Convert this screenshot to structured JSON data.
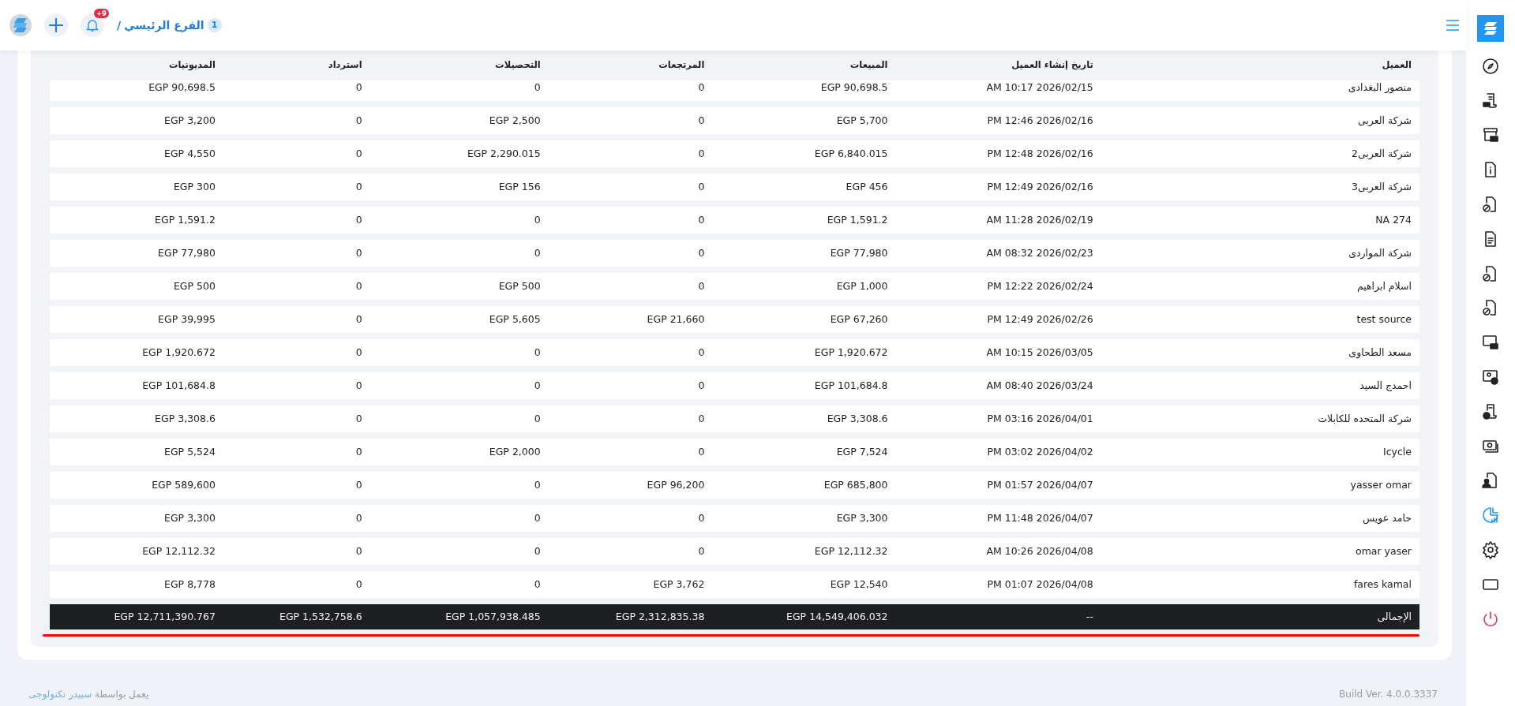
{
  "sidebar": {
    "items": [
      {
        "kind": "compass",
        "selected": false
      },
      {
        "kind": "receipt-cash",
        "selected": false
      },
      {
        "kind": "store-cash",
        "selected": false
      },
      {
        "kind": "document-info",
        "selected": false
      },
      {
        "kind": "document-block",
        "selected": false
      },
      {
        "kind": "document-lines",
        "selected": false
      },
      {
        "kind": "document-block",
        "selected": false
      },
      {
        "kind": "document-block",
        "selected": false
      },
      {
        "kind": "monitor-keyboard",
        "selected": false
      },
      {
        "kind": "badge-star",
        "selected": false
      },
      {
        "kind": "receipt-plus",
        "selected": false
      },
      {
        "kind": "cash-stack",
        "selected": false
      },
      {
        "kind": "document-user",
        "selected": false
      },
      {
        "kind": "chart",
        "selected": true
      },
      {
        "kind": "gear",
        "selected": false
      },
      {
        "kind": "rectangle",
        "selected": false
      },
      {
        "kind": "power",
        "selected": false
      }
    ]
  },
  "topbar": {
    "notification_count": "+9",
    "branch_number": "1",
    "branch_name": "الفرع الرئيسي",
    "separator": "/"
  },
  "table": {
    "columns": [
      "المديونيات",
      "استرداد",
      "التحصيلات",
      "المرتجعات",
      "المبيعات",
      "تاريخ إنشاء العميل",
      "العميل"
    ],
    "rows": [
      [
        "EGP 90,698.5",
        "0",
        "0",
        "0",
        "EGP 90,698.5",
        "2026/02/15 10:17 AM",
        "منصور البغدادى"
      ],
      [
        "EGP 3,200",
        "0",
        "EGP 2,500",
        "0",
        "EGP 5,700",
        "2026/02/16 12:46 PM",
        "شركة العربى"
      ],
      [
        "EGP 4,550",
        "0",
        "EGP 2,290.015",
        "0",
        "EGP 6,840.015",
        "2026/02/16 12:48 PM",
        "شركة العربى2"
      ],
      [
        "EGP 300",
        "0",
        "EGP 156",
        "0",
        "EGP 456",
        "2026/02/16 12:49 PM",
        "شركة العربى3"
      ],
      [
        "EGP 1,591.2",
        "0",
        "0",
        "0",
        "EGP 1,591.2",
        "2026/02/19 11:28 AM",
        "NA 274"
      ],
      [
        "EGP 77,980",
        "0",
        "0",
        "0",
        "EGP 77,980",
        "2026/02/23 08:32 AM",
        "شركة المواردى"
      ],
      [
        "EGP 500",
        "0",
        "EGP 500",
        "0",
        "EGP 1,000",
        "2026/02/24 12:22 PM",
        "اسلام ابراهيم"
      ],
      [
        "EGP 39,995",
        "0",
        "EGP 5,605",
        "EGP 21,660",
        "EGP 67,260",
        "2026/02/26 12:49 PM",
        "test source"
      ],
      [
        "EGP 1,920.672",
        "0",
        "0",
        "0",
        "EGP 1,920.672",
        "2026/03/05 10:15 AM",
        "مسعد الطحاوى"
      ],
      [
        "EGP 101,684.8",
        "0",
        "0",
        "0",
        "EGP 101,684.8",
        "2026/03/24 08:40 AM",
        "احمدج السيد"
      ],
      [
        "EGP 3,308.6",
        "0",
        "0",
        "0",
        "EGP 3,308.6",
        "2026/04/01 03:16 PM",
        "شركة المتحده للكابلات"
      ],
      [
        "EGP 5,524",
        "0",
        "EGP 2,000",
        "0",
        "EGP 7,524",
        "2026/04/02 03:02 PM",
        "Icycle"
      ],
      [
        "EGP 589,600",
        "0",
        "0",
        "EGP 96,200",
        "EGP 685,800",
        "2026/04/07 01:57 PM",
        "yasser omar"
      ],
      [
        "EGP 3,300",
        "0",
        "0",
        "0",
        "EGP 3,300",
        "2026/04/07 11:48 PM",
        "حامد عويس"
      ],
      [
        "EGP 12,112.32",
        "0",
        "0",
        "0",
        "EGP 12,112.32",
        "2026/04/08 10:26 AM",
        "omar yaser"
      ],
      [
        "EGP 8,778",
        "0",
        "0",
        "EGP 3,762",
        "EGP 12,540",
        "2026/04/08 01:07 PM",
        "fares kamal"
      ]
    ],
    "total": [
      "EGP 12,711,390.767",
      "EGP 1,532,758.6",
      "EGP 1,057,938.485",
      "EGP 2,312,835.38",
      "EGP 14,549,406.032",
      "--",
      "الإجمالى"
    ]
  },
  "footer": {
    "build": "Build Ver. 4.0.0.3337",
    "powered_by": "يعمل بواسطة",
    "company": "سبيدر تكنولوجى"
  }
}
